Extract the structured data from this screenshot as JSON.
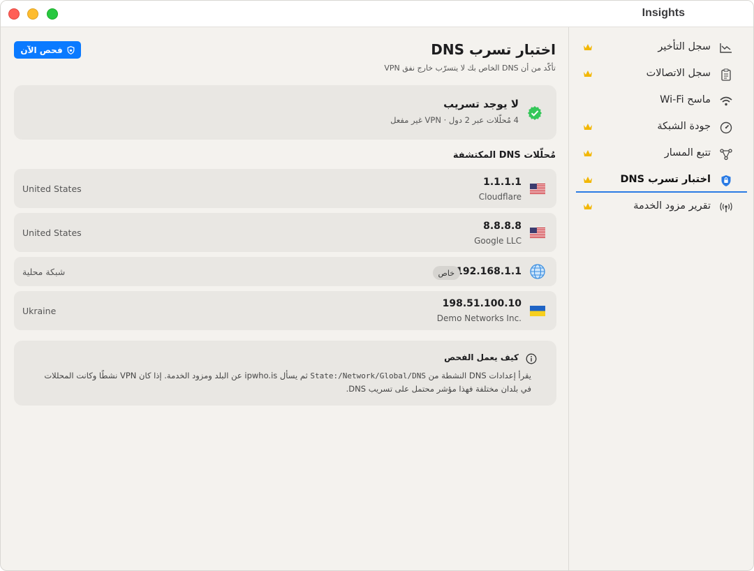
{
  "app": {
    "title": "Insights"
  },
  "sidebar": {
    "items": [
      {
        "label": "سجل التأخير",
        "icon": "chart-icon",
        "premium": true,
        "active": false
      },
      {
        "label": "سجل الاتصالات",
        "icon": "clipboard-icon",
        "premium": true,
        "active": false
      },
      {
        "label": "ماسح Wi-Fi",
        "icon": "wifi-icon",
        "premium": false,
        "active": false
      },
      {
        "label": "جودة الشبكة",
        "icon": "gauge-icon",
        "premium": true,
        "active": false
      },
      {
        "label": "تتبع المسار",
        "icon": "route-icon",
        "premium": true,
        "active": false
      },
      {
        "label": "اختبار تسرب DNS",
        "icon": "shield-icon",
        "premium": true,
        "active": true
      },
      {
        "label": "تقرير مزود الخدمة",
        "icon": "antenna-icon",
        "premium": true,
        "active": false
      }
    ]
  },
  "main": {
    "title": "اختبار تسرب DNS",
    "subtitle": "تأكّد من أن DNS الخاص بك لا يتسرّب خارج نفق VPN",
    "scan_button": "فحص الآن",
    "status": {
      "title": "لا يوجد تسريب",
      "detail": "4 مُحلّلات عبر 2 دول · VPN غير مفعل"
    },
    "resolvers_heading": "مُحلّلات DNS المكتشفة",
    "resolvers": [
      {
        "ip": "1.1.1.1",
        "org": "Cloudflare",
        "country": "United States",
        "flag": "us-flag"
      },
      {
        "ip": "8.8.8.8",
        "org": "Google LLC",
        "country": "United States",
        "flag": "us-flag"
      },
      {
        "ip": "192.168.1.1",
        "org": "",
        "badge": "خاص",
        "country": "شبكة محلية",
        "flag": "globe-icon"
      },
      {
        "ip": "198.51.100.10",
        "org": "Demo Networks Inc.",
        "country": "Ukraine",
        "flag": "ua-flag"
      }
    ],
    "info": {
      "title": "كيف يعمل الفحص",
      "body_part1": "يقرأ إعدادات DNS النشطة من",
      "body_code": "State:/Network/Global/DNS",
      "body_part2": "ثم يسأل ipwho.is عن البلد ومزود الخدمة. إذا كان VPN نشطًا وكانت المحللات في بلدان مختلفة فهذا مؤشر محتمل على تسريب DNS."
    }
  },
  "colors": {
    "accent": "#0a7aff",
    "success": "#34c759",
    "premium": "#f2b705"
  }
}
